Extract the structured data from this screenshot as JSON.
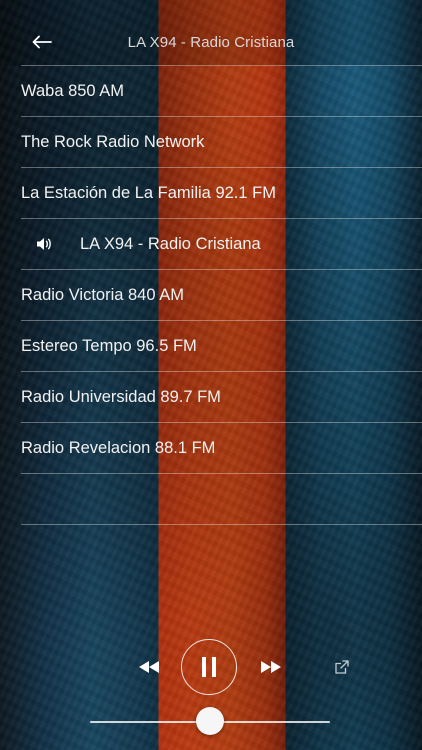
{
  "header": {
    "title": "LA X94 - Radio Cristiana",
    "back_icon": "arrow-left-icon"
  },
  "stations": [
    {
      "label": "Waba 850 AM",
      "active": false
    },
    {
      "label": "The Rock Radio Network",
      "active": false
    },
    {
      "label": "La Estación de La Familia 92.1 FM",
      "active": false
    },
    {
      "label": "LA X94 - Radio Cristiana",
      "active": true
    },
    {
      "label": "Radio Victoria 840 AM",
      "active": false
    },
    {
      "label": "Estereo Tempo 96.5 FM",
      "active": false
    },
    {
      "label": "Radio Universidad 89.7 FM",
      "active": false
    },
    {
      "label": "Radio Revelacion 88.1 FM",
      "active": false
    }
  ],
  "player": {
    "state": "playing",
    "icons": {
      "rewind": "rewind-icon",
      "pause": "pause-icon",
      "fast_forward": "fast-forward-icon",
      "share": "share-icon",
      "now_playing": "speaker-icon"
    },
    "volume": 0.5
  },
  "colors": {
    "text": "#f2f2f2",
    "divider": "rgba(255,255,255,0.35)",
    "red_band": "#f25318",
    "blue": "#1a4a66"
  }
}
